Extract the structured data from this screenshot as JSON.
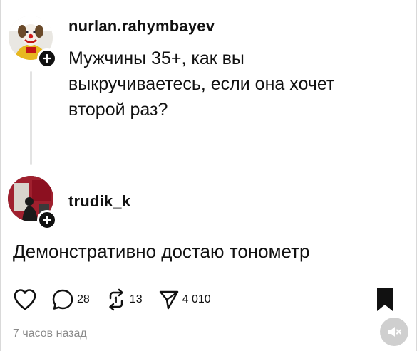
{
  "post": {
    "username": "nurlan.rahymbayev",
    "text_lines": [
      "Мужчины 35+, как вы",
      "выкручиваетесь, если она хочет",
      "второй раз?"
    ]
  },
  "reply": {
    "username": "trudik_k",
    "text": "Демонстративно достаю тонометр"
  },
  "actions": {
    "comments_count": "28",
    "reposts_count": "13",
    "shares_count": "4 010"
  },
  "meta": {
    "timestamp": "7 часов назад"
  },
  "icons": {
    "like": "heart-icon",
    "comment": "comment-bubble-icon",
    "repost": "repost-icon",
    "share": "send-icon",
    "bookmark": "bookmark-icon",
    "mute": "speaker-muted-icon",
    "follow": "plus-icon"
  },
  "colors": {
    "text": "#111111",
    "muted_text": "#8a8a8a",
    "thread_line": "#e3e3e3",
    "mute_button_bg": "#cfcfcf"
  }
}
